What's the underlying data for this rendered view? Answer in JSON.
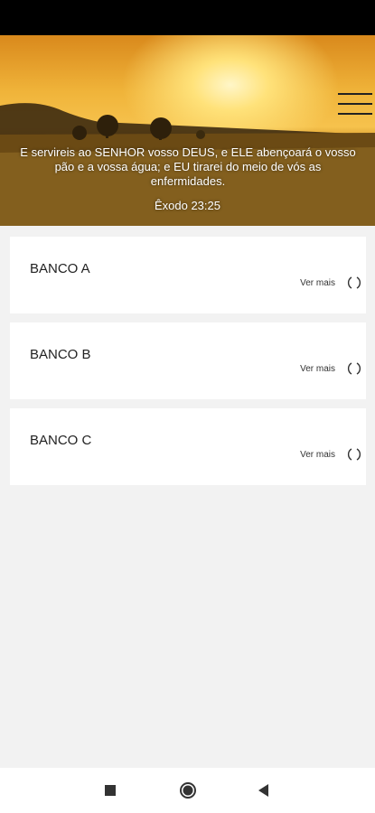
{
  "header": {
    "verse": "E servireis ao SENHOR vosso DEUS, e ELE abençoará o vosso pão e a vossa água; e EU tirarei do meio de vós as enfermidades.",
    "reference": "Êxodo 23:25",
    "menu_icon": "hamburger-icon"
  },
  "cards": [
    {
      "title": "BANCO A",
      "more_label": "Ver mais"
    },
    {
      "title": "BANCO B",
      "more_label": "Ver mais"
    },
    {
      "title": "BANCO C",
      "more_label": "Ver mais"
    }
  ],
  "nav": {
    "recents_icon": "square-icon",
    "home_icon": "circle-icon",
    "back_icon": "triangle-back-icon"
  }
}
